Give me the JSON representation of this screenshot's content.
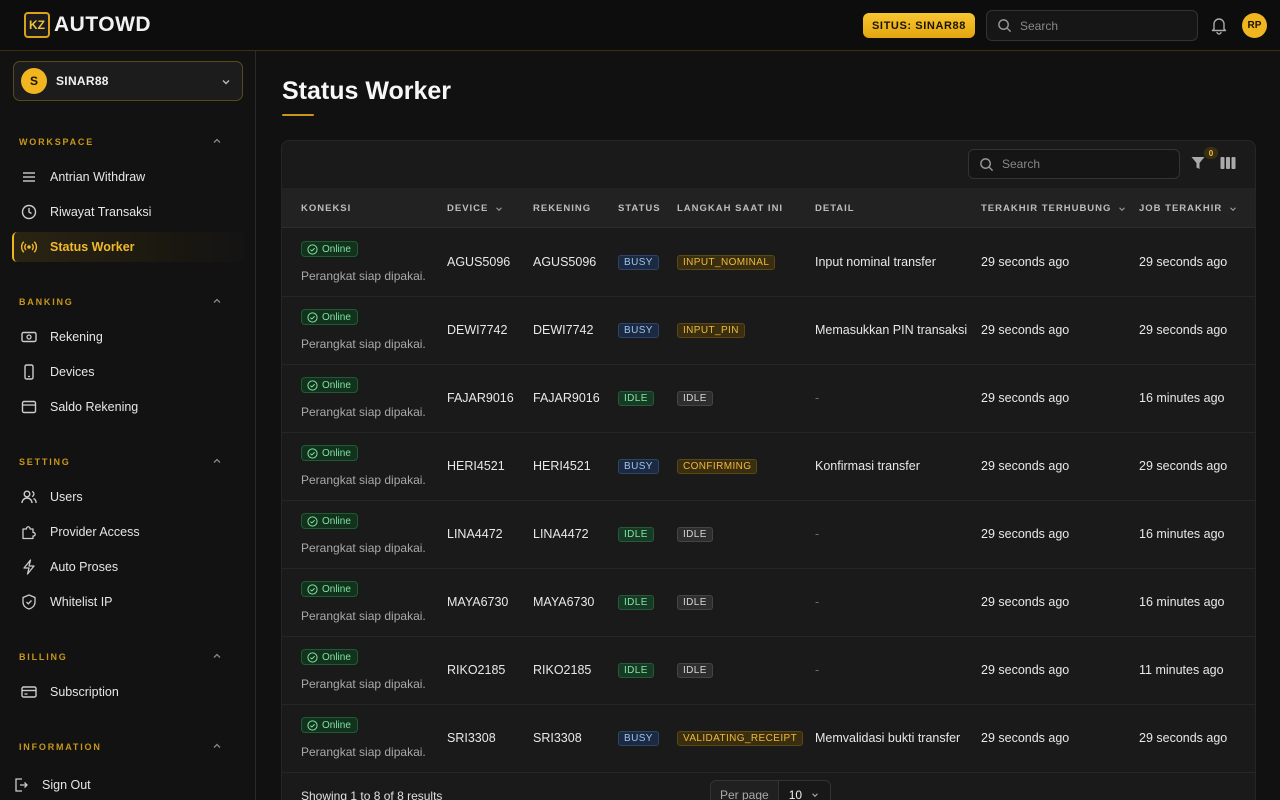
{
  "app": {
    "logo_badge": "KZ",
    "logo_text": "AUTOWD",
    "site_pill": "SITUS: SINAR88",
    "search_placeholder": "Search",
    "user_initials": "RP",
    "accent_color": "#f0b51f"
  },
  "sidebar": {
    "site": {
      "initial": "S",
      "name": "SINAR88"
    },
    "sections": [
      {
        "title": "WORKSPACE",
        "items": [
          {
            "label": "Antrian Withdraw",
            "icon": "list-icon"
          },
          {
            "label": "Riwayat Transaksi",
            "icon": "clock-icon"
          },
          {
            "label": "Status Worker",
            "icon": "broadcast-icon",
            "active": true
          }
        ]
      },
      {
        "title": "BANKING",
        "items": [
          {
            "label": "Rekening",
            "icon": "banknote-icon"
          },
          {
            "label": "Devices",
            "icon": "smartphone-icon"
          },
          {
            "label": "Saldo Rekening",
            "icon": "wallet-icon"
          }
        ]
      },
      {
        "title": "SETTING",
        "items": [
          {
            "label": "Users",
            "icon": "users-icon"
          },
          {
            "label": "Provider Access",
            "icon": "puzzle-icon"
          },
          {
            "label": "Auto Proses",
            "icon": "bolt-icon"
          },
          {
            "label": "Whitelist IP",
            "icon": "shield-icon"
          }
        ]
      },
      {
        "title": "BILLING",
        "items": [
          {
            "label": "Subscription",
            "icon": "credit-card-icon"
          }
        ]
      },
      {
        "title": "INFORMATION",
        "items": []
      }
    ],
    "sign_out": "Sign Out"
  },
  "main": {
    "title": "Status Worker",
    "table": {
      "search_placeholder": "Search",
      "filter_count": "0",
      "columns": [
        "KONEKSI",
        "DEVICE",
        "REKENING",
        "STATUS",
        "LANGKAH SAAT INI",
        "DETAIL",
        "TERAKHIR TERHUBUNG",
        "JOB TERAKHIR"
      ],
      "rows": [
        {
          "koneksi": "Online",
          "koneksi_desc": "Perangkat siap dipakai.",
          "device": "AGUS5096",
          "rekening": "AGUS5096",
          "status": "BUSY",
          "langkah": "INPUT_NOMINAL",
          "detail": "Input nominal transfer",
          "terakhir": "29 seconds ago",
          "job": "29 seconds ago"
        },
        {
          "koneksi": "Online",
          "koneksi_desc": "Perangkat siap dipakai.",
          "device": "DEWI7742",
          "rekening": "DEWI7742",
          "status": "BUSY",
          "langkah": "INPUT_PIN",
          "detail": "Memasukkan PIN transaksi",
          "terakhir": "29 seconds ago",
          "job": "29 seconds ago"
        },
        {
          "koneksi": "Online",
          "koneksi_desc": "Perangkat siap dipakai.",
          "device": "FAJAR9016",
          "rekening": "FAJAR9016",
          "status": "IDLE",
          "langkah": "IDLE",
          "detail": "-",
          "terakhir": "29 seconds ago",
          "job": "16 minutes ago"
        },
        {
          "koneksi": "Online",
          "koneksi_desc": "Perangkat siap dipakai.",
          "device": "HERI4521",
          "rekening": "HERI4521",
          "status": "BUSY",
          "langkah": "CONFIRMING",
          "detail": "Konfirmasi transfer",
          "terakhir": "29 seconds ago",
          "job": "29 seconds ago"
        },
        {
          "koneksi": "Online",
          "koneksi_desc": "Perangkat siap dipakai.",
          "device": "LINA4472",
          "rekening": "LINA4472",
          "status": "IDLE",
          "langkah": "IDLE",
          "detail": "-",
          "terakhir": "29 seconds ago",
          "job": "16 minutes ago"
        },
        {
          "koneksi": "Online",
          "koneksi_desc": "Perangkat siap dipakai.",
          "device": "MAYA6730",
          "rekening": "MAYA6730",
          "status": "IDLE",
          "langkah": "IDLE",
          "detail": "-",
          "terakhir": "29 seconds ago",
          "job": "16 minutes ago"
        },
        {
          "koneksi": "Online",
          "koneksi_desc": "Perangkat siap dipakai.",
          "device": "RIKO2185",
          "rekening": "RIKO2185",
          "status": "IDLE",
          "langkah": "IDLE",
          "detail": "-",
          "terakhir": "29 seconds ago",
          "job": "11 minutes ago"
        },
        {
          "koneksi": "Online",
          "koneksi_desc": "Perangkat siap dipakai.",
          "device": "SRI3308",
          "rekening": "SRI3308",
          "status": "BUSY",
          "langkah": "VALIDATING_RECEIPT",
          "detail": "Memvalidasi bukti transfer",
          "terakhir": "29 seconds ago",
          "job": "29 seconds ago"
        }
      ],
      "footer_text": "Showing 1 to 8 of 8 results",
      "per_page_label": "Per page",
      "per_page_value": "10"
    }
  }
}
